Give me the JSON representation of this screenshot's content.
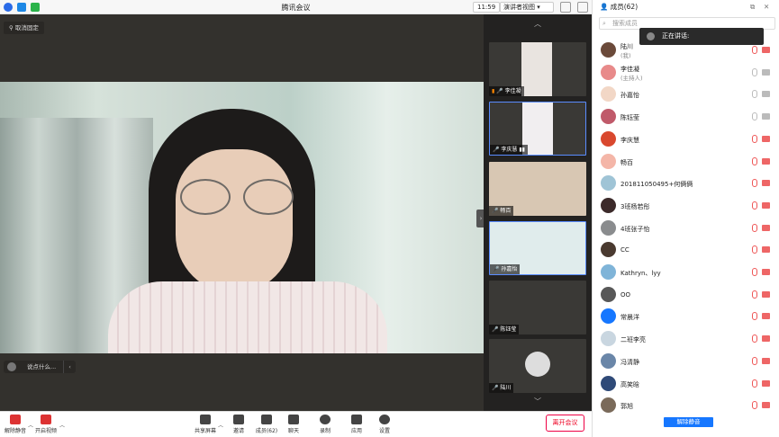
{
  "window": {
    "title": "腾讯会议",
    "time": "11:59",
    "view_mode": "演讲者视图"
  },
  "stage": {
    "unpin_label": "取消固定",
    "chat_placeholder": "说点什么...",
    "collapse_glyph": "›"
  },
  "strip": {
    "up_glyph": "︿",
    "down_glyph": "﹀",
    "tiles": [
      {
        "name": "李佳凝",
        "bg": "#e9e4e0"
      },
      {
        "name": "李庆慧",
        "bg": "#f1eef0"
      },
      {
        "name": "畅百",
        "bg": "#d8c7b3"
      },
      {
        "name": "孙嘉怡",
        "bg": "#e0ecec"
      },
      {
        "name": "陈钰莹",
        "bg": "#3a3936"
      },
      {
        "name": "陆川",
        "bg": "#3a3936"
      }
    ]
  },
  "toolbar": {
    "unmute": "解除静音",
    "video": "开启视频",
    "share": "共享屏幕",
    "invite": "邀请",
    "members": "成员(62)",
    "chat": "聊天",
    "record": "录制",
    "apps": "应用",
    "settings": "设置",
    "leave": "离开会议"
  },
  "panel": {
    "title": "成员(62)",
    "search_placeholder": "搜索成员",
    "speaking_label": "正在讲话:",
    "unmute_all": "解除静音",
    "members": [
      {
        "name": "陆川",
        "sub": "(我)",
        "color": "#6b4a3a"
      },
      {
        "name": "李佳凝",
        "sub": "(主持人)",
        "color": "#e88a8a"
      },
      {
        "name": "孙嘉怡",
        "sub": "",
        "color": "#f2d7c6"
      },
      {
        "name": "陈钰莹",
        "sub": "",
        "color": "#c05a6a"
      },
      {
        "name": "李庆慧",
        "sub": "",
        "color": "#d9482e"
      },
      {
        "name": "畅百",
        "sub": "",
        "color": "#f4b6a8"
      },
      {
        "name": "201811050495+何俩俩",
        "sub": "",
        "color": "#9fc4d6"
      },
      {
        "name": "3班杨若彤",
        "sub": "",
        "color": "#3c2a2a"
      },
      {
        "name": "4班张子怡",
        "sub": "",
        "color": "#8a8c8e"
      },
      {
        "name": "CC",
        "sub": "",
        "color": "#4a3a30"
      },
      {
        "name": "Kathryn、lyy",
        "sub": "",
        "color": "#7fb4d8"
      },
      {
        "name": "OO",
        "sub": "",
        "color": "#585858"
      },
      {
        "name": "常晨洋",
        "sub": "",
        "color": "#1677ff"
      },
      {
        "name": "二班李亮",
        "sub": "",
        "color": "#c9d6e0"
      },
      {
        "name": "冯清静",
        "sub": "",
        "color": "#6a86a8"
      },
      {
        "name": "高笑晗",
        "sub": "",
        "color": "#2f4a78"
      },
      {
        "name": "郭旭",
        "sub": "",
        "color": "#7a6a5a"
      }
    ]
  }
}
